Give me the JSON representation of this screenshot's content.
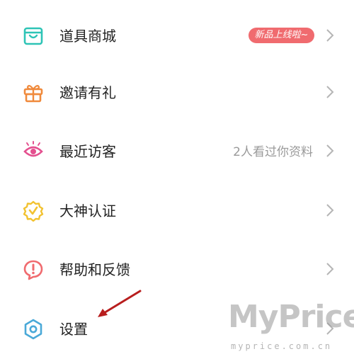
{
  "menu": {
    "items": [
      {
        "label": "道具商城",
        "icon": "shopping-bag-icon",
        "badge": "新品上线啦~"
      },
      {
        "label": "邀请有礼",
        "icon": "gift-icon"
      },
      {
        "label": "最近访客",
        "icon": "eye-icon",
        "extra": "2人看过你资料"
      },
      {
        "label": "大神认证",
        "icon": "verified-badge-icon"
      },
      {
        "label": "帮助和反馈",
        "icon": "help-feedback-icon"
      },
      {
        "label": "设置",
        "icon": "settings-gear-icon"
      }
    ]
  },
  "watermark": {
    "title": "MyPrice",
    "url": "myprice.com.cn"
  },
  "colors": {
    "shop": "#2ec4b6",
    "gift": "#f08a3c",
    "eye": "#e4508f",
    "verified": "#f2c230",
    "help": "#f06b6f",
    "settings": "#4aa9d8",
    "badge": "#f06b6f",
    "arrow": "#b81e1e"
  }
}
